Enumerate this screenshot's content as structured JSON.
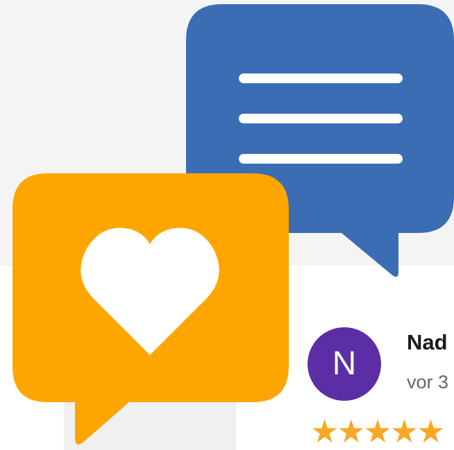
{
  "review": {
    "avatar_letter": "N",
    "reviewer_name": "Nad",
    "time_text": "vor 3",
    "stars": "★★★★★",
    "rating": 5
  },
  "icons": {
    "message_bubble": "chat-lines-icon",
    "heart_bubble": "heart-chat-icon"
  },
  "colors": {
    "blue_bubble": "#3a6db4",
    "orange_bubble": "#ffa500",
    "avatar_bg": "#5b2ea6",
    "star": "#f9a825",
    "background": "#f4f4f4"
  }
}
